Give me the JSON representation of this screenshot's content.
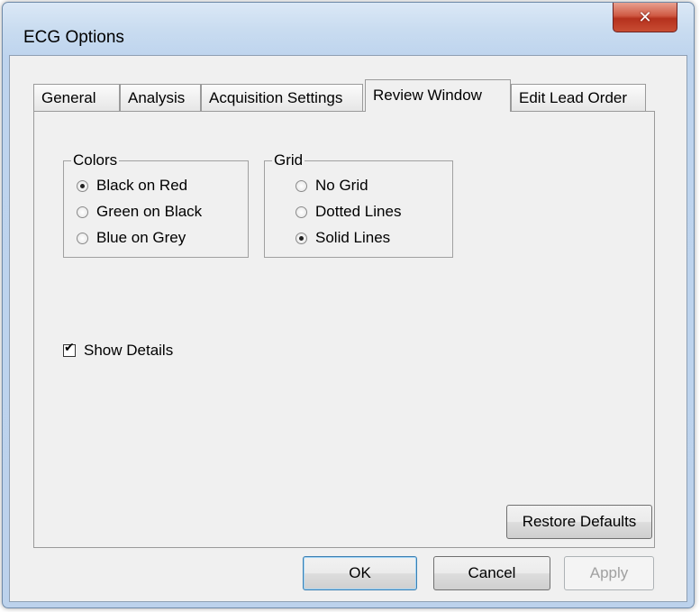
{
  "window": {
    "title": "ECG Options",
    "close_icon": "✕"
  },
  "tabs": [
    {
      "label": "General"
    },
    {
      "label": "Analysis"
    },
    {
      "label": "Acquisition Settings"
    },
    {
      "label": "Review Window",
      "active": true
    },
    {
      "label": "Edit Lead Order"
    }
  ],
  "colors_group": {
    "label": "Colors",
    "options": [
      {
        "label": "Black on Red",
        "checked": true
      },
      {
        "label": "Green on Black",
        "checked": false
      },
      {
        "label": "Blue on Grey",
        "checked": false
      }
    ]
  },
  "grid_group": {
    "label": "Grid",
    "options": [
      {
        "label": "No Grid",
        "checked": false
      },
      {
        "label": "Dotted Lines",
        "checked": false
      },
      {
        "label": "Solid Lines",
        "checked": true
      }
    ]
  },
  "show_details": {
    "label": "Show Details",
    "checked": true
  },
  "buttons": {
    "restore_defaults": "Restore Defaults",
    "ok": "OK",
    "cancel": "Cancel",
    "apply": "Apply"
  }
}
